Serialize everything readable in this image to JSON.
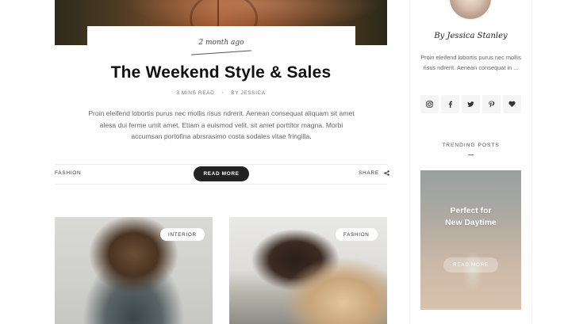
{
  "article": {
    "date": "2 month ago",
    "title": "The Weekend Style & Sales",
    "read_time": "3 MINS READ",
    "author": "BY JESSICA",
    "excerpt": "Proin eleifend lobortis purus nec mollis risus ndrerit. Aenean consequat aliquam sit amet alesa dui ferme umit amet. Etiam a euismod velit, sit amet porttitor magna. Morbi accumsan portofina abrsrasimo costa sodales vitae fringilla.",
    "category": "FASHION",
    "read_more_label": "READ MORE",
    "share_label": "SHARE"
  },
  "grid_posts": [
    {
      "badge": "INTERIOR"
    },
    {
      "badge": "FASHION"
    }
  ],
  "sidebar": {
    "signature": "By Jessica Stanley",
    "bio": "Proin eleifend lobortis purus nec mollis risus ndrerit. Aenean consequat in ...",
    "social_icons": [
      "instagram-icon",
      "facebook-icon",
      "twitter-icon",
      "pinterest-icon",
      "heart-icon"
    ],
    "trending_title": "TRENDING POSTS",
    "trending_post": {
      "headline_line1": "Perfect for",
      "headline_line2": "New Daytime",
      "read_more_label": "READ MORE"
    }
  },
  "colors": {
    "primary_dark": "#222222",
    "text_muted": "#666666",
    "background": "#ffffff"
  }
}
